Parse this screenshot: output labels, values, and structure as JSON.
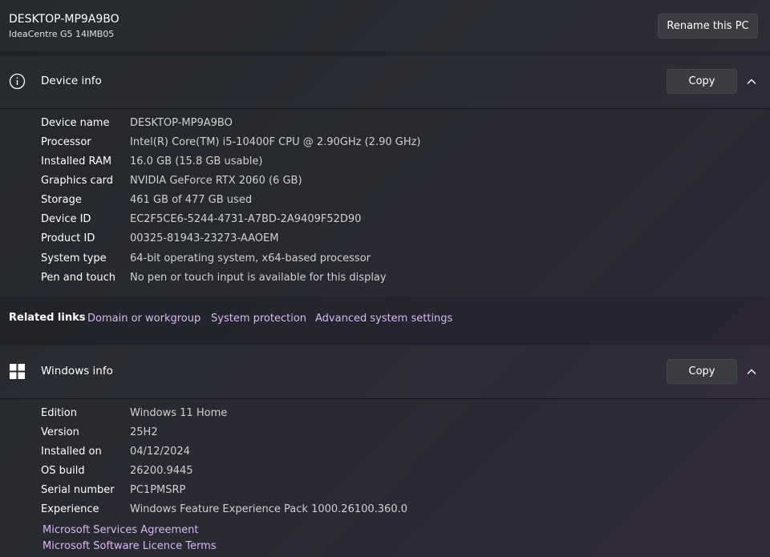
{
  "pc": {
    "name": "DESKTOP-MP9A9BO",
    "model": "IdeaCentre G5 14IMB05",
    "rename_label": "Rename this PC"
  },
  "device_info": {
    "title": "Device info",
    "copy_label": "Copy",
    "icon": "info-icon",
    "rows": [
      {
        "label": "Device name",
        "value": "DESKTOP-MP9A9BO"
      },
      {
        "label": "Processor",
        "value": "Intel(R) Core(TM) i5-10400F CPU @ 2.90GHz (2.90 GHz)"
      },
      {
        "label": "Installed RAM",
        "value": "16.0 GB (15.8 GB usable)"
      },
      {
        "label": "Graphics card",
        "value": "NVIDIA GeForce RTX 2060 (6 GB)"
      },
      {
        "label": "Storage",
        "value": "461 GB of 477 GB used"
      },
      {
        "label": "Device ID",
        "value": "EC2F5CE6-5244-4731-A7BD-2A9409F52D90"
      },
      {
        "label": "Product ID",
        "value": "00325-81943-23273-AAOEM"
      },
      {
        "label": "System type",
        "value": "64-bit operating system, x64-based processor"
      },
      {
        "label": "Pen and touch",
        "value": "No pen or touch input is available for this display"
      }
    ]
  },
  "related_links": {
    "title": "Related links",
    "links": [
      "Domain or workgroup",
      "System protection",
      "Advanced system settings"
    ]
  },
  "windows_info": {
    "title": "Windows info",
    "copy_label": "Copy",
    "icon": "windows-logo-icon",
    "rows": [
      {
        "label": "Edition",
        "value": "Windows 11 Home"
      },
      {
        "label": "Version",
        "value": "25H2"
      },
      {
        "label": "Installed on",
        "value": "04/12/2024"
      },
      {
        "label": "OS build",
        "value": "26200.9445"
      },
      {
        "label": "Serial number",
        "value": "PC1PMSRP"
      },
      {
        "label": "Experience",
        "value": "Windows Feature Experience Pack 1000.26100.360.0"
      }
    ],
    "links": [
      "Microsoft Services Agreement",
      "Microsoft Software Licence Terms"
    ]
  },
  "colors": {
    "link": "#d9b8f0",
    "value_text": "#d0d0d0",
    "button_bg": "#3a3c42"
  }
}
